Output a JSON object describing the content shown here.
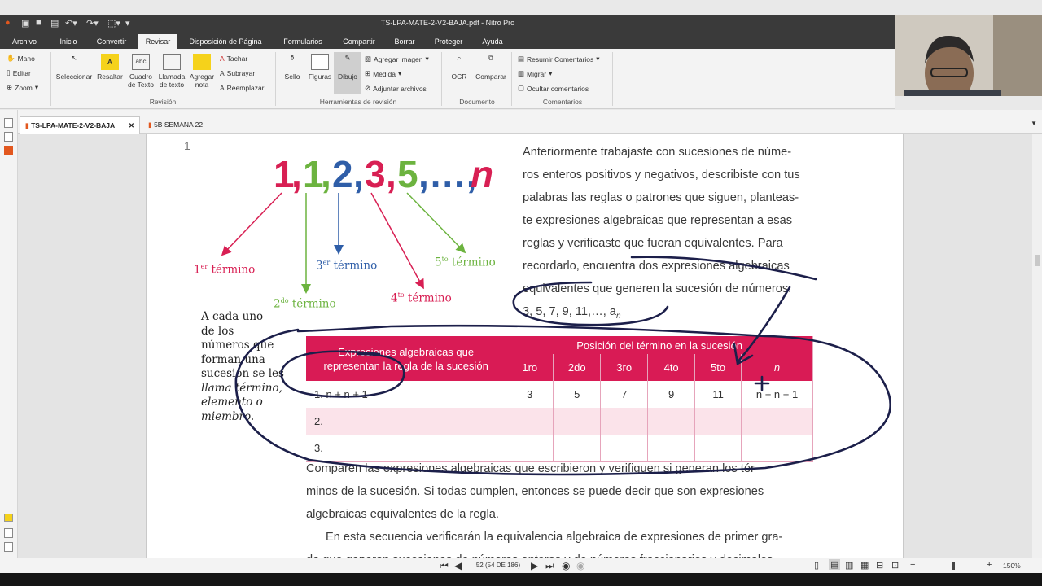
{
  "window_title": "TS-LPA-MATE-2-V2-BAJA.pdf - Nitro Pro",
  "menu_tabs": [
    "Archivo",
    "Inicio",
    "Convertir",
    "Revisar",
    "Disposición de Página",
    "Formularios",
    "Compartir",
    "Borrar",
    "Proteger",
    "Ayuda"
  ],
  "active_tab": "Revisar",
  "ribbon": {
    "nav": [
      "Mano",
      "Editar",
      "Zoom"
    ],
    "revision_buttons": [
      "Seleccionar",
      "Resaltar",
      "Cuadro\nde Texto",
      "Llamada\nde texto",
      "Agregar\nnota"
    ],
    "revision_small": [
      "Tachar",
      "Subrayar",
      "Reemplazar"
    ],
    "revision_group": "Revisión",
    "tools_buttons": [
      "Sello",
      "Figuras",
      "Dibujo"
    ],
    "tools_small": [
      "Agregar imagen",
      "Medida",
      "Adjuntar archivos"
    ],
    "tools_group": "Herramientas de revisión",
    "doc_buttons": [
      "OCR",
      "Comparar"
    ],
    "doc_group": "Documento",
    "comments_small": [
      "Resumir Comentarios",
      "Migrar",
      "Ocultar comentarios"
    ],
    "comments_group": "Comentarios"
  },
  "doc_tabs": [
    "TS-LPA-MATE-2-V2-BAJA",
    "5B SEMANA 22"
  ],
  "page_content": {
    "margin_number": "1",
    "sequence": [
      {
        "t": "1",
        "c": "#d81f53"
      },
      {
        "t": ",",
        "c": "#d81f53"
      },
      {
        "t": "1",
        "c": "#6cb33f"
      },
      {
        "t": ",",
        "c": "#6cb33f"
      },
      {
        "t": "2",
        "c": "#2f5ea8"
      },
      {
        "t": ",",
        "c": "#2f5ea8"
      },
      {
        "t": "3",
        "c": "#d81f53"
      },
      {
        "t": ",",
        "c": "#d81f53"
      },
      {
        "t": "5",
        "c": "#6cb33f"
      },
      {
        "t": ",…,",
        "c": "#2f5ea8"
      },
      {
        "t": "n",
        "c": "#d81f53"
      }
    ],
    "terms": [
      {
        "num": "1",
        "sup": "er",
        "word": " término",
        "color": "#d81f53"
      },
      {
        "num": "2",
        "sup": "do",
        "word": " término",
        "color": "#6cb33f"
      },
      {
        "num": "3",
        "sup": "er",
        "word": " término",
        "color": "#2f5ea8"
      },
      {
        "num": "4",
        "sup": "to",
        "word": " término",
        "color": "#d81f53"
      },
      {
        "num": "5",
        "sup": "to",
        "word": " término",
        "color": "#6cb33f"
      }
    ],
    "side_note_lines": [
      "A cada uno",
      "de los",
      "números que",
      "forman una",
      "sucesión se les",
      "llama término,",
      "elemento o",
      "miembro."
    ],
    "intro_lines": [
      "Anteriormente trabajaste con sucesiones de núme-",
      "ros enteros positivos y negativos, describiste con tus",
      "palabras las reglas o patrones que siguen, planteas-",
      "te expresiones algebraicas que representan a esas",
      "reglas y verificaste que fueran equivalentes. Para",
      "recordarlo, encuentra dos expresiones algebraicas",
      "equivalentes que generen la sucesión de números:"
    ],
    "sequence_given": "3, 5, 7, 9, 11,…, a",
    "sequence_sub": "n",
    "table": {
      "header_left": "Expresiones algebraicas que representan la regla de la sucesión",
      "header_right": "Posición del término en la sucesión",
      "positions": [
        "1ro",
        "2do",
        "3ro",
        "4to",
        "5to",
        "n"
      ],
      "rows": [
        {
          "label": "1. n + n + 1",
          "values": [
            "3",
            "5",
            "7",
            "9",
            "11",
            "n + n + 1"
          ]
        },
        {
          "label": "2.",
          "values": [
            "",
            "",
            "",
            "",
            "",
            ""
          ]
        },
        {
          "label": "3.",
          "values": [
            "",
            "",
            "",
            "",
            "",
            ""
          ]
        }
      ]
    },
    "closing_lines": [
      "Comparen las expresiones algebraicas que escribieron y verifiquen si generan los tér-",
      "minos de la sucesión. Si todas cumplen, entonces se puede decir que son expresiones",
      "algebraicas equivalentes de la regla.",
      "En esta secuencia verificarán la equivalencia algebraica de expresiones de primer gra-",
      "do que generan sucesiones de números enteros y de números fraccionarios y decimales."
    ]
  },
  "status": {
    "page_indicator": "52 (54 DE 186)",
    "zoom": "150%"
  },
  "colors": {
    "accent": "#d91b55",
    "ink": "#1c1f4a"
  }
}
